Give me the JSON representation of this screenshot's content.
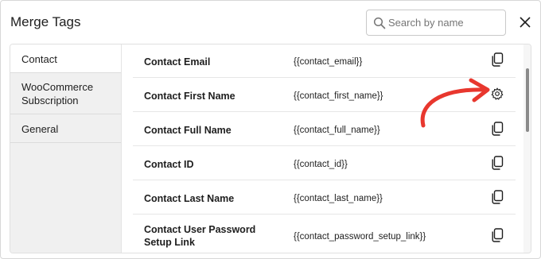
{
  "modal": {
    "title": "Merge Tags",
    "search_placeholder": "Search by name"
  },
  "sidebar": {
    "items": [
      {
        "label": "Contact",
        "active": true
      },
      {
        "label": "WooCommerce Subscription",
        "active": false
      },
      {
        "label": "General",
        "active": false
      }
    ]
  },
  "tags": [
    {
      "name": "Contact Email",
      "tag": "{{contact_email}}",
      "action_icon": "copy-icon"
    },
    {
      "name": "Contact First Name",
      "tag": "{{contact_first_name}}",
      "action_icon": "gear-icon"
    },
    {
      "name": "Contact Full Name",
      "tag": "{{contact_full_name}}",
      "action_icon": "copy-icon"
    },
    {
      "name": "Contact ID",
      "tag": "{{contact_id}}",
      "action_icon": "copy-icon"
    },
    {
      "name": "Contact Last Name",
      "tag": "{{contact_last_name}}",
      "action_icon": "copy-icon"
    },
    {
      "name": "Contact User Password Setup Link",
      "tag": "{{contact_password_setup_link}}",
      "action_icon": "copy-icon"
    }
  ],
  "colors": {
    "annotation_arrow": "#e8372e",
    "sidebar_bg": "#f0f0f0"
  }
}
